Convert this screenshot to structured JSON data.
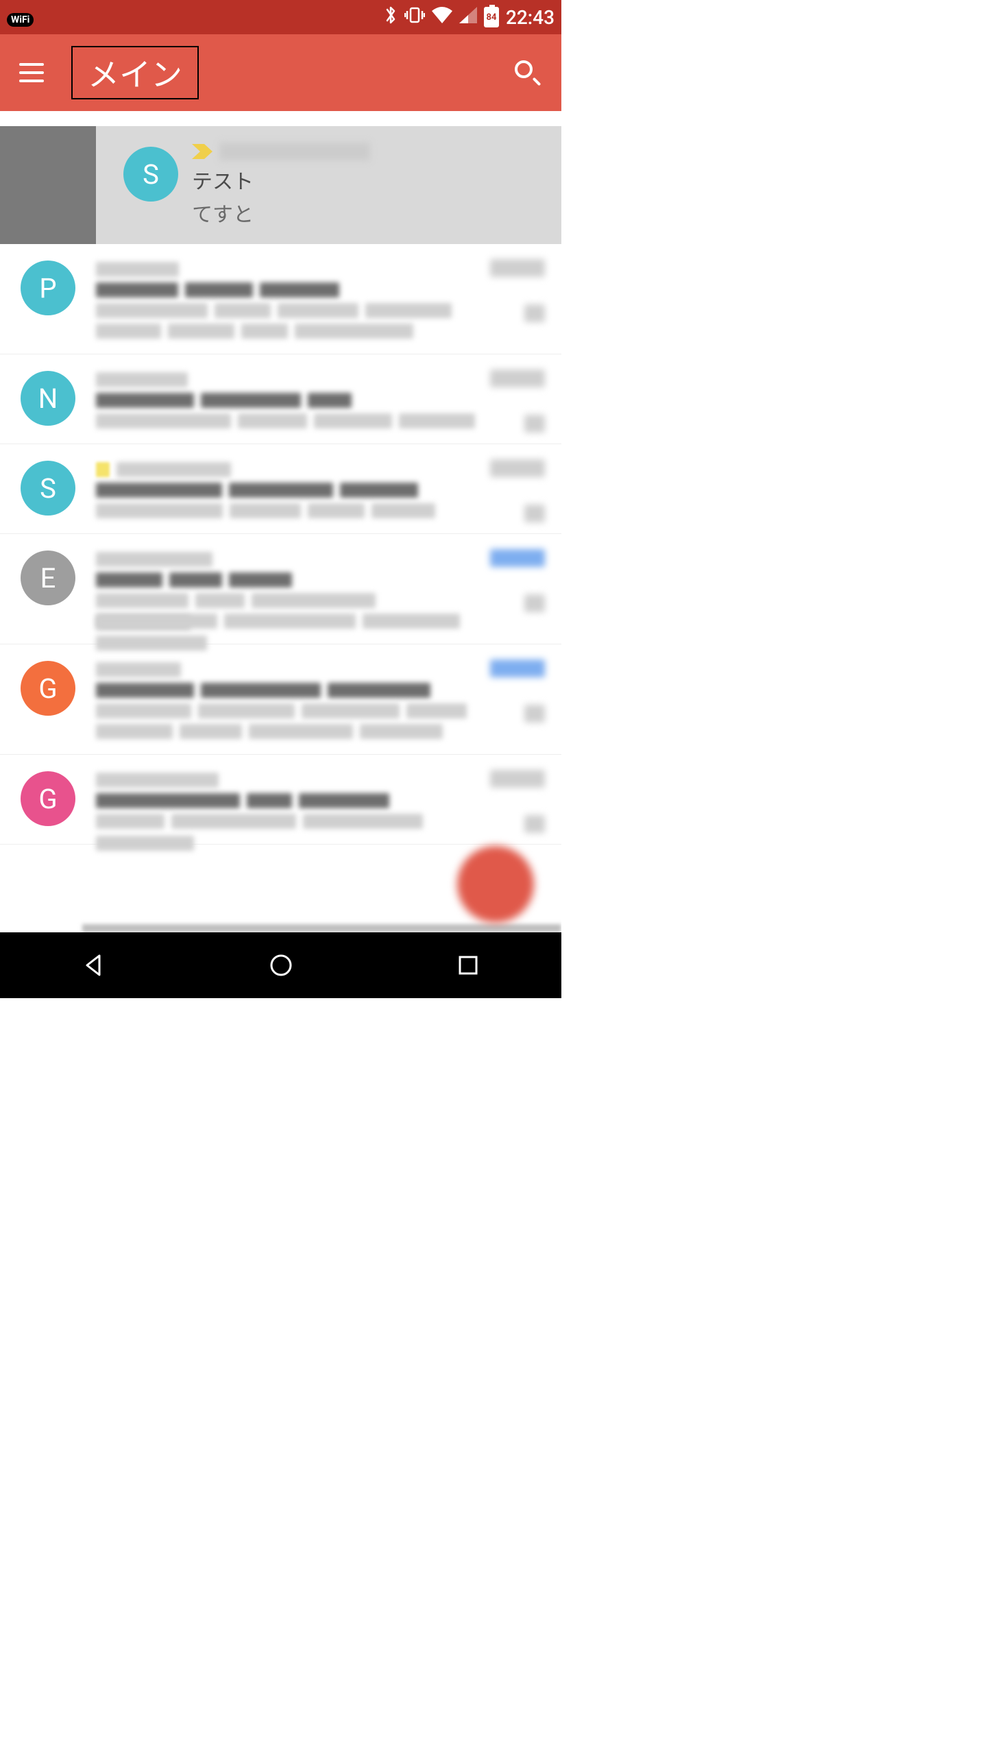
{
  "status": {
    "wifi_label": "WiFi",
    "battery_pct": "84",
    "time": "22:43"
  },
  "appbar": {
    "title": "メイン"
  },
  "pinned": {
    "avatar_letter": "S",
    "avatar_color": "#4bc0cf",
    "subject": "テスト",
    "snippet": "てすと"
  },
  "emails": [
    {
      "avatar_letter": "P",
      "avatar_color": "#4bc0cf",
      "meta_style": "gray"
    },
    {
      "avatar_letter": "N",
      "avatar_color": "#4bc0cf",
      "meta_style": "gray"
    },
    {
      "avatar_letter": "S",
      "avatar_color": "#4bc0cf",
      "meta_style": "gray",
      "has_yellow_tag": true
    },
    {
      "avatar_letter": "E",
      "avatar_color": "#9e9e9e",
      "meta_style": "blue"
    },
    {
      "avatar_letter": "G",
      "avatar_color": "#f36f3e",
      "meta_style": "blue"
    },
    {
      "avatar_letter": "G",
      "avatar_color": "#e8528d",
      "meta_style": "gray"
    }
  ]
}
